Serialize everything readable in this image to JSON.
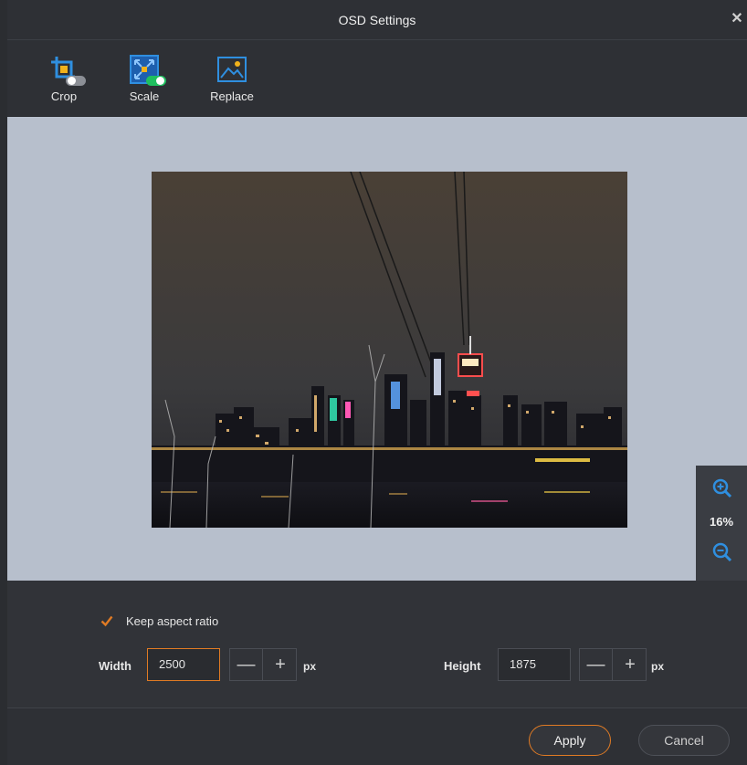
{
  "window": {
    "title": "OSD Settings",
    "close_glyph": "✕"
  },
  "toolbar": {
    "tools": [
      {
        "label": "Crop",
        "icon": "crop-icon",
        "toggle": "off"
      },
      {
        "label": "Scale",
        "icon": "scale-icon",
        "toggle": "on"
      },
      {
        "label": "Replace",
        "icon": "replace-image-icon"
      }
    ]
  },
  "preview": {
    "zoom_level": "16%",
    "zoom_in_icon": "zoom-in-icon",
    "zoom_out_icon": "zoom-out-icon"
  },
  "settings": {
    "keep_aspect_ratio": {
      "label": "Keep aspect ratio",
      "checked": true
    },
    "width": {
      "label": "Width",
      "value": "2500",
      "unit": "px"
    },
    "height": {
      "label": "Height",
      "value": "1875",
      "unit": "px"
    },
    "minus_glyph": "—",
    "plus_glyph": "+"
  },
  "footer": {
    "apply_label": "Apply",
    "cancel_label": "Cancel"
  },
  "colors": {
    "accent": "#e07b24",
    "icon_blue": "#2f8fe0",
    "toggle_green": "#1fbf5f",
    "preview_bg": "#b7bfcc"
  }
}
